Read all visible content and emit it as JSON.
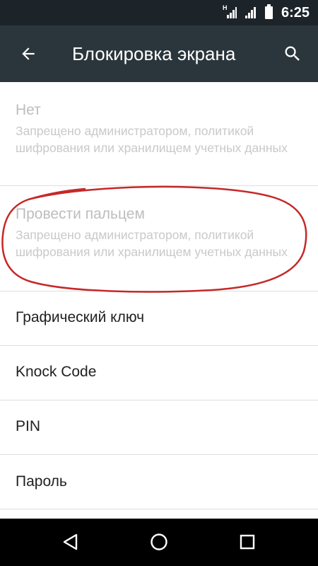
{
  "status_bar": {
    "network_label": "H",
    "time": "6:25"
  },
  "app_bar": {
    "title": "Блокировка экрана",
    "back_icon": "arrow-back-icon",
    "search_icon": "search-icon"
  },
  "items": [
    {
      "title": "Нет",
      "summary": "Запрещено администратором, политикой шифрования или хранилищем учетных данных",
      "enabled": false
    },
    {
      "title": "Провести пальцем",
      "summary": "Запрещено администратором, политикой шифрования или хранилищем учетных данных",
      "enabled": false
    },
    {
      "title": "Графический ключ",
      "enabled": true
    },
    {
      "title": "Knock Code",
      "enabled": true
    },
    {
      "title": "PIN",
      "enabled": true
    },
    {
      "title": "Пароль",
      "enabled": true
    }
  ],
  "annotation": {
    "shape": "hand-drawn-ellipse",
    "color": "#c62828"
  },
  "nav_bar": {
    "back_icon": "nav-back-triangle-icon",
    "home_icon": "nav-home-circle-icon",
    "recents_icon": "nav-recents-square-icon"
  }
}
